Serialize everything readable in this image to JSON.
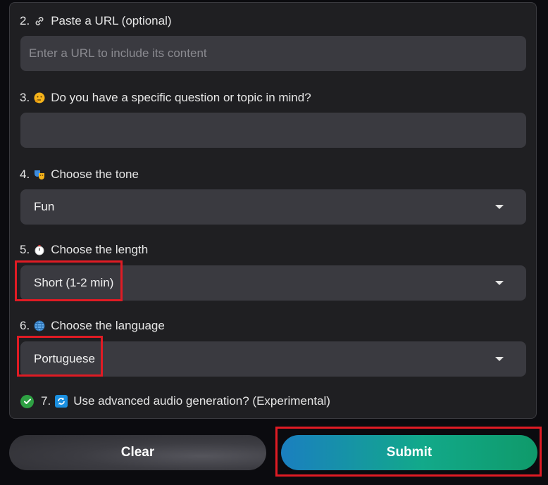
{
  "url_field": {
    "number": "2.",
    "label": "Paste a URL (optional)",
    "icon": "link-icon",
    "placeholder": "Enter a URL to include its content",
    "value": ""
  },
  "question_field": {
    "number": "3.",
    "label": "Do you have a specific question or topic in mind?",
    "icon": "thinking-face-icon",
    "value": ""
  },
  "tone_field": {
    "number": "4.",
    "label": "Choose the tone",
    "icon": "theater-masks-icon",
    "selected": "Fun"
  },
  "length_field": {
    "number": "5.",
    "label": "Choose the length",
    "icon": "stopwatch-icon",
    "selected": "Short (1-2 min)"
  },
  "language_field": {
    "number": "6.",
    "label": "Choose the language",
    "icon": "globe-icon",
    "selected": "Portuguese"
  },
  "advanced_audio": {
    "number": "7.",
    "label": "Use advanced audio generation? (Experimental)",
    "icon": "arrows-cycle-icon",
    "checked": true
  },
  "buttons": {
    "clear_label": "Clear",
    "submit_label": "Submit"
  },
  "colors": {
    "highlight": "#e01b24",
    "submit_gradient_start": "#1a7fc0",
    "submit_gradient_end": "#0f9a6a",
    "checkbox": "#2ea043"
  }
}
